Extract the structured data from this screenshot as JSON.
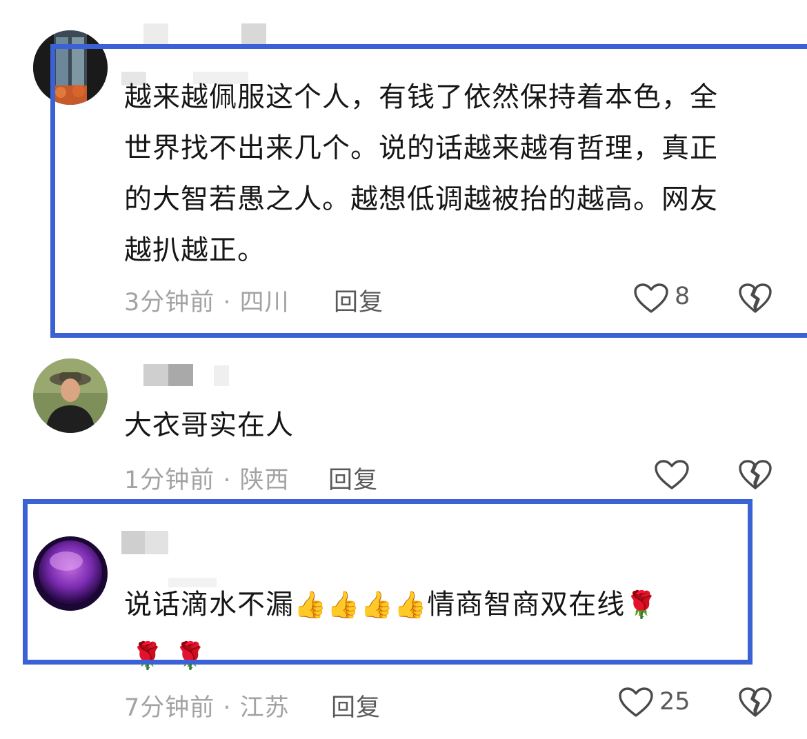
{
  "comments": [
    {
      "lines": [
        "越来越佩服这个人，有钱了依然保持着本色，全",
        "世界找不出来几个。说的话越来越有哲理，真正",
        "的大智若愚之人。越想低调越被抬的越高。网友",
        "越扒越正。"
      ],
      "meta": "3分钟前 · 四川",
      "reply": "回复",
      "likes": "8",
      "like_icon": "heart-outline-icon",
      "dislike_icon": "broken-heart-icon"
    },
    {
      "lines": [
        "大衣哥实在人"
      ],
      "meta": "1分钟前 · 陕西",
      "reply": "回复",
      "likes": "",
      "like_icon": "heart-outline-icon",
      "dislike_icon": "broken-heart-icon"
    },
    {
      "line1_prefix": "说话滴水不漏",
      "thumbs": [
        "👍",
        "👍",
        "👍",
        "👍"
      ],
      "line1_suffix": "情商智商双在线",
      "roses": [
        "🌹",
        "🌹",
        "🌹"
      ],
      "meta": "7分钟前 · 江苏",
      "reply": "回复",
      "likes": "25",
      "like_icon": "heart-outline-icon",
      "dislike_icon": "broken-heart-icon"
    }
  ],
  "colors": {
    "highlight": "#3b62d4",
    "meta": "#a3a3a3",
    "text": "#161616"
  }
}
